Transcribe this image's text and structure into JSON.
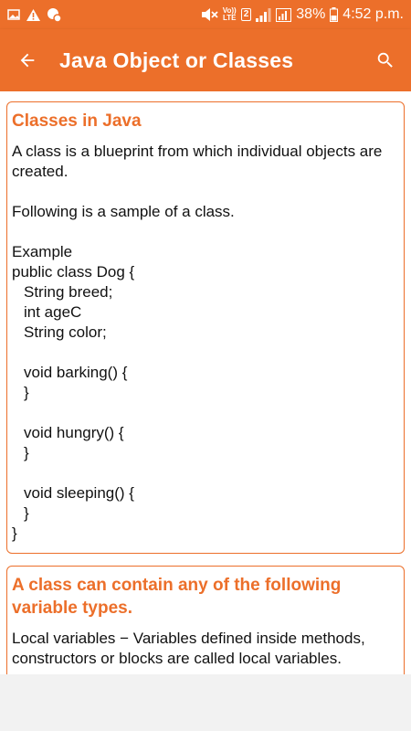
{
  "status_bar": {
    "lte_top": "Vo))",
    "lte_bottom": "LTE",
    "sim": "2",
    "battery": "38%",
    "time": "4:52 p.m."
  },
  "app_bar": {
    "title": "Java Object or Classes"
  },
  "card1": {
    "title": "Classes in Java",
    "intro": "A class is a blueprint from which individual objects are created.",
    "sample": "Following is a sample of a class.",
    "example_label": "Example",
    "code": {
      "class_decl": "public class Dog {",
      "field1": "String breed;",
      "field2": "int ageC",
      "field3": "String color;",
      "method1": "void barking() {",
      "method2": "void hungry() {",
      "method3": "void sleeping() {",
      "close_brace": "}"
    }
  },
  "card2": {
    "title": "A class can contain any of the following variable types.",
    "body": "Local variables − Variables defined inside methods, constructors or blocks are called local variables."
  }
}
